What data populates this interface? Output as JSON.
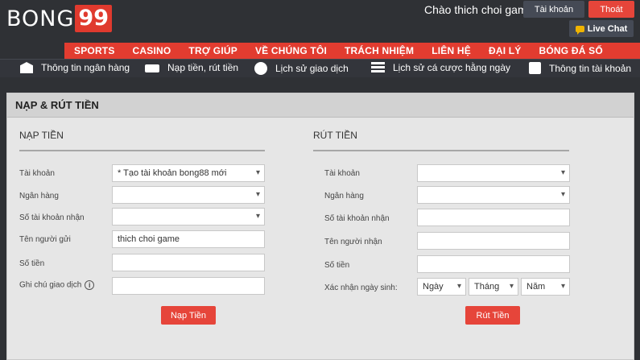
{
  "brand": {
    "logo_text": "BONG",
    "logo_badge": "99",
    "accent": "#e23c30"
  },
  "header": {
    "greeting": "Chào thich choi game",
    "account_button": "Tài khoản",
    "logout_button": "Thoát",
    "livechat_button": "Live Chat"
  },
  "main_nav": [
    "SPORTS",
    "CASINO",
    "TRỢ GIÚP",
    "VỀ CHÚNG TÔI",
    "TRÁCH NHIỆM",
    "LIÊN HỆ",
    "ĐẠI LÝ",
    "BÓNG ĐÁ SỐ"
  ],
  "sub_nav": [
    {
      "label": "Thông tin ngân hàng",
      "icon": "bank-icon"
    },
    {
      "label": "Nạp tiền, rút tiền",
      "icon": "cash-icon"
    },
    {
      "label": "Lịch sử giao dịch",
      "icon": "refresh-icon"
    },
    {
      "label": "Lịch sử cá cược hằng ngày",
      "icon": "list-icon"
    },
    {
      "label": "Thông tin tài khoản",
      "icon": "user-icon"
    }
  ],
  "panel": {
    "title": "NẠP & RÚT TIỀN"
  },
  "deposit": {
    "title": "NẠP TIỀN",
    "labels": {
      "account": "Tài khoản",
      "bank": "Ngân hàng",
      "receive_account": "Số tài khoản nhận",
      "sender_name": "Tên người gửi",
      "amount": "Số tiền",
      "note": "Ghi chú giao dịch"
    },
    "values": {
      "account": "* Tạo tài khoản bong88 mới",
      "bank": "",
      "receive_account": "",
      "sender_name": "thich choi game",
      "amount": "",
      "note": ""
    },
    "submit": "Nạp Tiền"
  },
  "withdraw": {
    "title": "RÚT TIỀN",
    "labels": {
      "account": "Tài khoản",
      "bank": "Ngân hàng",
      "account_number": "Số tài khoản nhận",
      "receiver_name": "Tên người nhận",
      "amount": "Số tiền",
      "dob": "Xác nhận ngày sinh:"
    },
    "dob_selects": {
      "day": "Ngày",
      "month": "Tháng",
      "year": "Năm"
    },
    "submit": "Rút Tiền"
  }
}
